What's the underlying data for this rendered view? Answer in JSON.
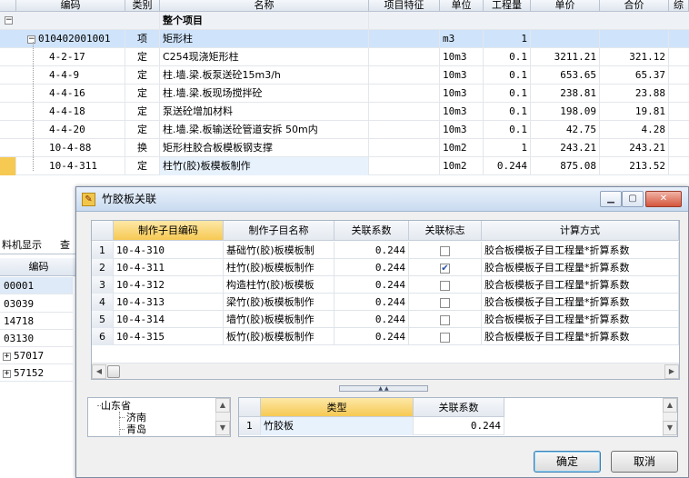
{
  "main_grid": {
    "columns": [
      "编码",
      "类别",
      "名称",
      "项目特征",
      "单位",
      "工程量",
      "单价",
      "合价",
      "综"
    ],
    "group_row": {
      "label": "整个项目"
    },
    "rows": [
      {
        "code": "010402001001",
        "type": "项",
        "name": "矩形柱",
        "unit": "m3",
        "qty": "1",
        "price": "",
        "total": ""
      },
      {
        "code": "4-2-17",
        "type": "定",
        "name": "C254现浇矩形柱",
        "unit": "10m3",
        "qty": "0.1",
        "price": "3211.21",
        "total": "321.12"
      },
      {
        "code": "4-4-9",
        "type": "定",
        "name": "柱.墙.梁.板泵送砼15m3/h",
        "unit": "10m3",
        "qty": "0.1",
        "price": "653.65",
        "total": "65.37"
      },
      {
        "code": "4-4-16",
        "type": "定",
        "name": "柱.墙.梁.板现场搅拌砼",
        "unit": "10m3",
        "qty": "0.1",
        "price": "238.81",
        "total": "23.88"
      },
      {
        "code": "4-4-18",
        "type": "定",
        "name": "泵送砼增加材料",
        "unit": "10m3",
        "qty": "0.1",
        "price": "198.09",
        "total": "19.81"
      },
      {
        "code": "4-4-20",
        "type": "定",
        "name": "柱.墙.梁.板输送砼管道安拆 50m内",
        "unit": "10m3",
        "qty": "0.1",
        "price": "42.75",
        "total": "4.28"
      },
      {
        "code": "10-4-88",
        "type": "换",
        "name": "矩形柱胶合板模板钢支撑",
        "unit": "10m2",
        "qty": "1",
        "price": "243.21",
        "total": "243.21"
      },
      {
        "code": "10-4-311",
        "type": "定",
        "name": "柱竹(胶)板模板制作",
        "unit": "10m2",
        "qty": "0.244",
        "price": "875.08",
        "total": "213.52"
      }
    ]
  },
  "left_panel": {
    "tab_label": "料机显示",
    "tab2_label": "查",
    "column": "编码",
    "items": [
      "00001",
      "03039",
      "14718",
      "03130",
      "57017",
      "57152"
    ]
  },
  "dialog": {
    "title": "竹胶板关联",
    "columns": [
      "制作子目编码",
      "制作子目名称",
      "关联系数",
      "关联标志",
      "计算方式"
    ],
    "rows": [
      {
        "n": "1",
        "code": "10-4-310",
        "name": "基础竹(胶)板模板制",
        "coef": "0.244",
        "checked": false,
        "method": "胶合板模板子目工程量*折算系数"
      },
      {
        "n": "2",
        "code": "10-4-311",
        "name": "柱竹(胶)板模板制作",
        "coef": "0.244",
        "checked": true,
        "method": "胶合板模板子目工程量*折算系数"
      },
      {
        "n": "3",
        "code": "10-4-312",
        "name": "构造柱竹(胶)板模板",
        "coef": "0.244",
        "checked": false,
        "method": "胶合板模板子目工程量*折算系数"
      },
      {
        "n": "4",
        "code": "10-4-313",
        "name": "梁竹(胶)板模板制作",
        "coef": "0.244",
        "checked": false,
        "method": "胶合板模板子目工程量*折算系数"
      },
      {
        "n": "5",
        "code": "10-4-314",
        "name": "墙竹(胶)板模板制作",
        "coef": "0.244",
        "checked": false,
        "method": "胶合板模板子目工程量*折算系数"
      },
      {
        "n": "6",
        "code": "10-4-315",
        "name": "板竹(胶)板模板制作",
        "coef": "0.244",
        "checked": false,
        "method": "胶合板模板子目工程量*折算系数"
      }
    ],
    "tree": [
      "山东省",
      "济南",
      "青岛"
    ],
    "type_table": {
      "columns": [
        "类型",
        "关联系数"
      ],
      "rows": [
        {
          "n": "1",
          "type": "竹胶板",
          "coef": "0.244"
        }
      ]
    },
    "ok_label": "确定",
    "cancel_label": "取消"
  }
}
